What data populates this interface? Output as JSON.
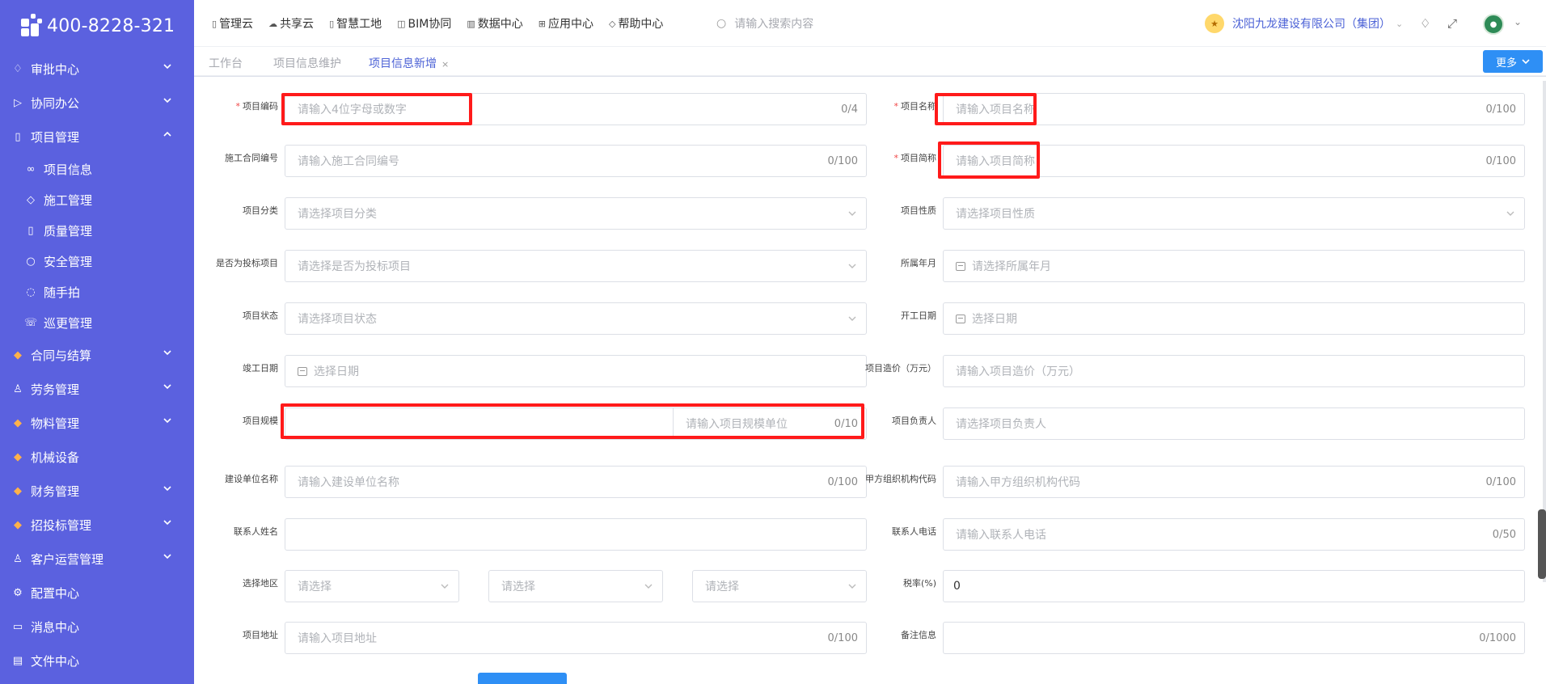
{
  "logo": {
    "phone": "400-8228-321"
  },
  "sidebar": {
    "items": [
      {
        "label": "审批中心",
        "icon": "bell-icon"
      },
      {
        "label": "协同办公",
        "icon": "send-icon"
      },
      {
        "label": "项目管理",
        "icon": "book-icon",
        "expanded": true,
        "children": [
          {
            "label": "项目信息",
            "icon": "glasses-icon"
          },
          {
            "label": "施工管理",
            "icon": "tag-icon"
          },
          {
            "label": "质量管理",
            "icon": "book-icon"
          },
          {
            "label": "安全管理",
            "icon": "shield-icon"
          },
          {
            "label": "随手拍",
            "icon": "camera-icon"
          },
          {
            "label": "巡更管理",
            "icon": "phone-icon"
          }
        ]
      },
      {
        "label": "合同与结算",
        "icon": "gem-icon"
      },
      {
        "label": "劳务管理",
        "icon": "user-icon"
      },
      {
        "label": "物料管理",
        "icon": "gem-icon"
      },
      {
        "label": "机械设备",
        "icon": "gem-icon"
      },
      {
        "label": "财务管理",
        "icon": "gem-icon"
      },
      {
        "label": "招投标管理",
        "icon": "gem-icon"
      },
      {
        "label": "客户运营管理",
        "icon": "user-icon"
      },
      {
        "label": "配置中心",
        "icon": "gear-icon"
      },
      {
        "label": "消息中心",
        "icon": "chat-icon"
      },
      {
        "label": "文件中心",
        "icon": "file-icon"
      }
    ]
  },
  "topnav": {
    "links": [
      "管理云",
      "共享云",
      "智慧工地",
      "BIM协同",
      "数据中心",
      "应用中心",
      "帮助中心"
    ],
    "search_placeholder": "请输入搜索内容",
    "company": "沈阳九龙建设有限公司（集团）"
  },
  "tabs": {
    "items": [
      "工作台",
      "项目信息维护",
      "项目信息新增"
    ],
    "active_index": 2,
    "more_label": "更多"
  },
  "form": {
    "project_code": {
      "label": "项目编码",
      "placeholder": "请输入4位字母或数字",
      "count": "0/4"
    },
    "project_name": {
      "label": "项目名称",
      "placeholder": "请输入项目名称",
      "count": "0/100"
    },
    "contract_no": {
      "label": "施工合同编号",
      "placeholder": "请输入施工合同编号",
      "count": "0/100"
    },
    "short_name": {
      "label": "项目简称",
      "placeholder": "请输入项目简称",
      "count": "0/100"
    },
    "category": {
      "label": "项目分类",
      "placeholder": "请选择项目分类"
    },
    "nature": {
      "label": "项目性质",
      "placeholder": "请选择项目性质"
    },
    "is_bid": {
      "label": "是否为投标项目",
      "placeholder": "请选择是否为投标项目"
    },
    "year_month": {
      "label": "所属年月",
      "placeholder": "请选择所属年月"
    },
    "status": {
      "label": "项目状态",
      "placeholder": "请选择项目状态"
    },
    "start_date": {
      "label": "开工日期",
      "placeholder": "选择日期"
    },
    "finish_date": {
      "label": "竣工日期",
      "placeholder": "选择日期"
    },
    "cost": {
      "label": "项目造价（万元）",
      "placeholder": "请输入项目造价（万元）"
    },
    "scale": {
      "label": "项目规模",
      "unit_placeholder": "请输入项目规模单位",
      "count": "0/10"
    },
    "manager": {
      "label": "项目负责人",
      "placeholder": "请选择项目负责人"
    },
    "build_unit": {
      "label": "建设单位名称",
      "placeholder": "请输入建设单位名称",
      "count": "0/100"
    },
    "org_code": {
      "label": "甲方组织机构代码",
      "placeholder": "请输入甲方组织机构代码",
      "count": "0/100"
    },
    "contact_name": {
      "label": "联系人姓名",
      "placeholder": ""
    },
    "contact_phone": {
      "label": "联系人电话",
      "placeholder": "请输入联系人电话",
      "count": "0/50"
    },
    "region": {
      "label": "选择地区",
      "placeholders": [
        "请选择",
        "请选择",
        "请选择"
      ]
    },
    "tax_rate": {
      "label": "税率(%)",
      "value": "0"
    },
    "address": {
      "label": "项目地址",
      "placeholder": "请输入项目地址",
      "count": "0/100"
    },
    "remark": {
      "label": "备注信息",
      "placeholder": "",
      "count": "0/1000"
    }
  },
  "colors": {
    "sidebar": "#5b61df",
    "accent": "#2e8ff5",
    "highlight": "#ff1a1a"
  }
}
